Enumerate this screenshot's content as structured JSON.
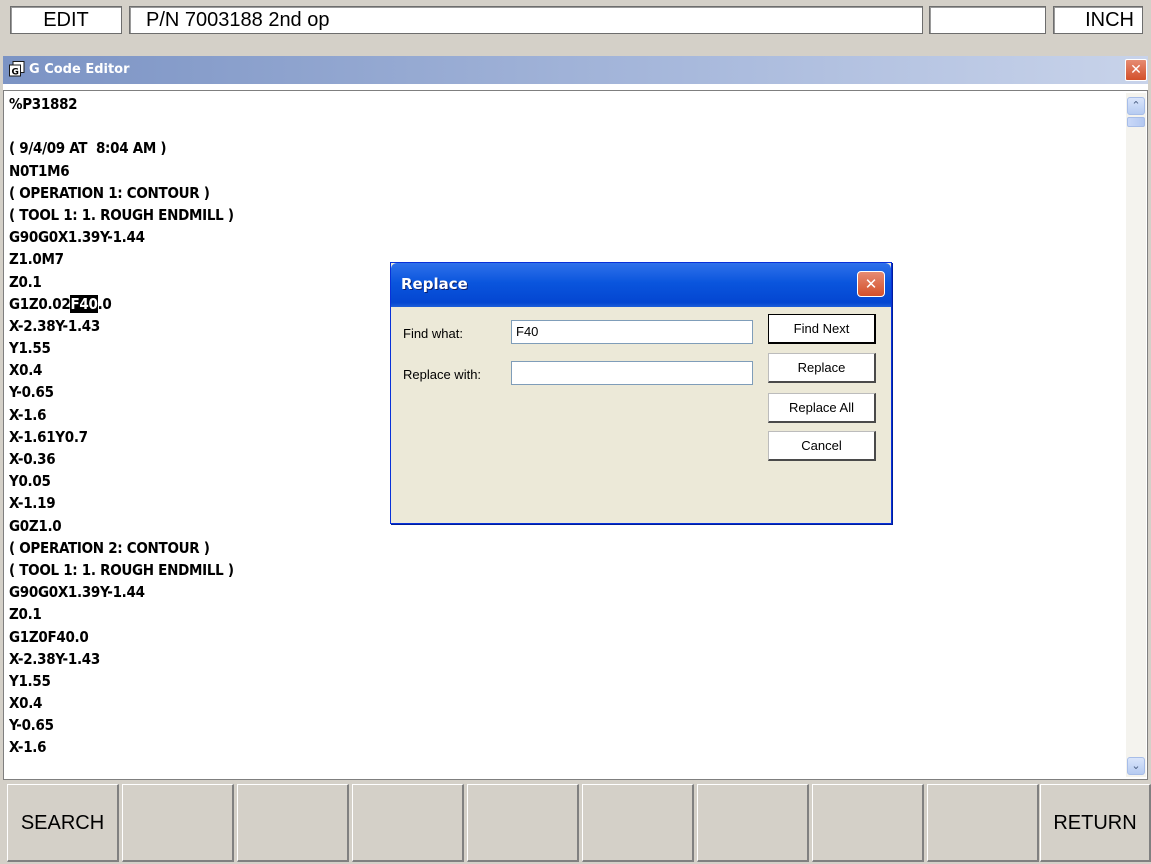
{
  "status_bar": {
    "mode": "EDIT",
    "program_name": "P/N 7003188 2nd op",
    "blank": "",
    "units": "INCH"
  },
  "editor": {
    "title": "G Code Editor",
    "code_lines": [
      "%P31882",
      "",
      "( 9/4/09 AT  8:04 AM )",
      "N0T1M6",
      "( OPERATION 1: CONTOUR )",
      "( TOOL 1: 1. ROUGH ENDMILL )",
      "G90G0X1.39Y-1.44",
      "Z1.0M7",
      "Z0.1",
      "G1Z0.02F40.0",
      "X-2.38Y-1.43",
      "Y1.55",
      "X0.4",
      "Y-0.65",
      "X-1.6",
      "X-1.61Y0.7",
      "X-0.36",
      "Y0.05",
      "X-1.19",
      "G0Z1.0",
      "( OPERATION 2: CONTOUR )",
      "( TOOL 1: 1. ROUGH ENDMILL )",
      "G90G0X1.39Y-1.44",
      "Z0.1",
      "G1Z0F40.0",
      "X-2.38Y-1.43",
      "Y1.55",
      "X0.4",
      "Y-0.65",
      "X-1.6"
    ],
    "highlight": {
      "line": 9,
      "before": "G1Z0.02",
      "match": "F40",
      "after": ".0"
    }
  },
  "replace_dialog": {
    "title": "Replace",
    "find_label": "Find what:",
    "find_value": "F40",
    "replace_label": "Replace with:",
    "replace_value": "",
    "buttons": {
      "find_next": "Find Next",
      "replace": "Replace",
      "replace_all": "Replace All",
      "cancel": "Cancel"
    }
  },
  "softkeys": [
    "SEARCH",
    "",
    "",
    "",
    "",
    "",
    "",
    "",
    "",
    "RETURN"
  ]
}
